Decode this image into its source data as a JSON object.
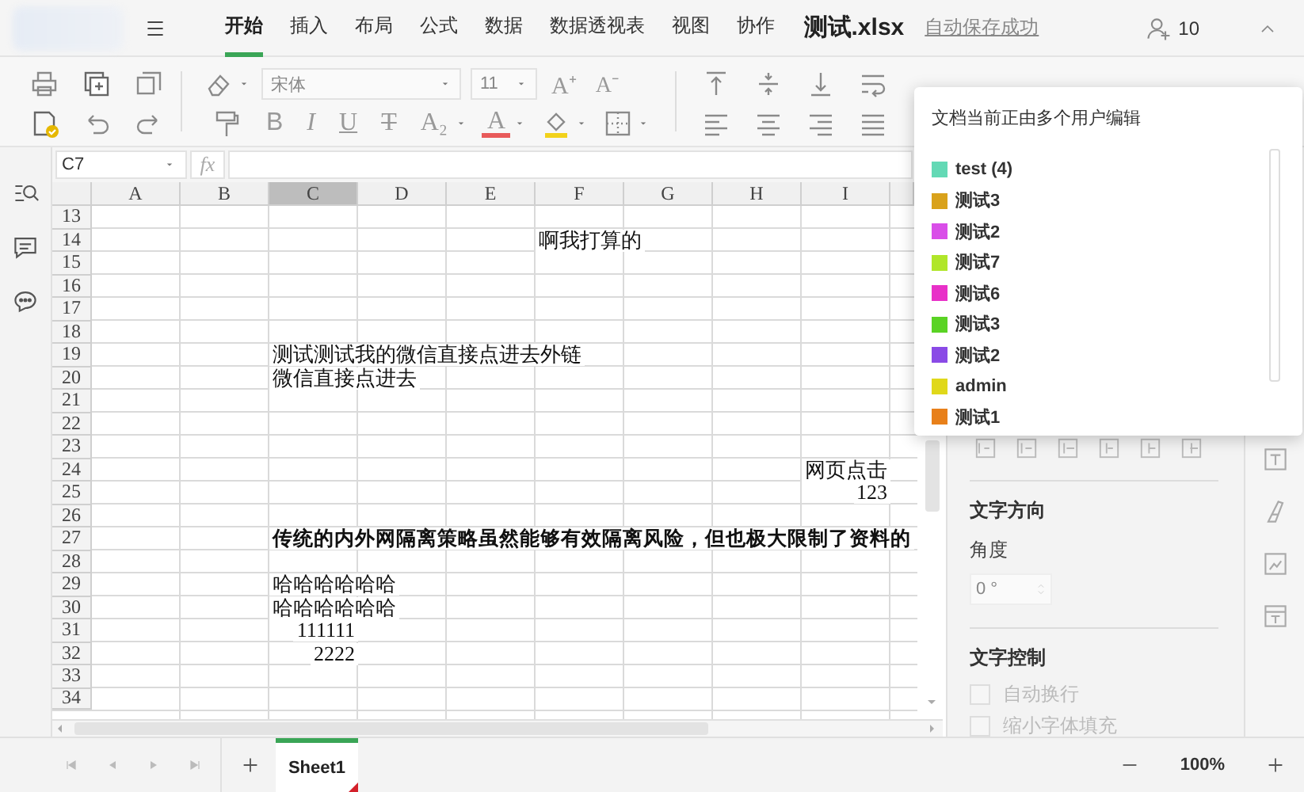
{
  "app_bar": {
    "tabs": [
      {
        "label": "开始",
        "selected": true
      },
      {
        "label": "插入",
        "selected": false
      },
      {
        "label": "布局",
        "selected": false
      },
      {
        "label": "公式",
        "selected": false
      },
      {
        "label": "数据",
        "selected": false
      },
      {
        "label": "数据透视表",
        "selected": false
      },
      {
        "label": "视图",
        "selected": false
      },
      {
        "label": "协作",
        "selected": false
      }
    ],
    "file_name": "测试.xlsx",
    "save_status": "自动保存成功",
    "collaborator_count": "10"
  },
  "toolbar": {
    "font_name": "宋体",
    "font_size": "11",
    "size_buttons": [
      {
        "kind": "grow",
        "glyph": "A⁺"
      },
      {
        "kind": "shrink",
        "glyph": "A⁻"
      }
    ],
    "style_buttons": [
      {
        "kind": "bold",
        "glyph": "B"
      },
      {
        "kind": "italic",
        "glyph": "I"
      },
      {
        "kind": "underline",
        "glyph": "U"
      },
      {
        "kind": "strike",
        "glyph": "T"
      },
      {
        "kind": "subscript",
        "glyph": "A₂"
      },
      {
        "kind": "font_color",
        "glyph": "A"
      }
    ]
  },
  "formula_bar": {
    "cell_ref": "C7",
    "function_label": "fx"
  },
  "sheet": {
    "columns": [
      {
        "label": "A",
        "selected": false
      },
      {
        "label": "B",
        "selected": false
      },
      {
        "label": "C",
        "selected": true
      },
      {
        "label": "D",
        "selected": false
      },
      {
        "label": "E",
        "selected": false
      },
      {
        "label": "F",
        "selected": false
      },
      {
        "label": "G",
        "selected": false
      },
      {
        "label": "H",
        "selected": false
      },
      {
        "label": "I",
        "selected": false
      }
    ],
    "rows": [
      {
        "number": "13"
      },
      {
        "number": "14",
        "f": {
          "text": "啊我打算的",
          "kind": "text",
          "bold": false
        }
      },
      {
        "number": "15"
      },
      {
        "number": "16"
      },
      {
        "number": "17"
      },
      {
        "number": "18"
      },
      {
        "number": "19",
        "c": {
          "text": "测试测试我的微信直接点进去外链",
          "kind": "text",
          "bold": false
        }
      },
      {
        "number": "20",
        "c": {
          "text": "微信直接点进去",
          "kind": "text",
          "bold": false
        }
      },
      {
        "number": "21"
      },
      {
        "number": "22"
      },
      {
        "number": "23"
      },
      {
        "number": "24",
        "i": {
          "text": "网页点击",
          "kind": "text",
          "bold": false
        }
      },
      {
        "number": "25",
        "i": {
          "text": "123",
          "kind": "number",
          "bold": false
        }
      },
      {
        "number": "26"
      },
      {
        "number": "27",
        "c": {
          "text": "传统的内外网隔离策略虽然能够有效隔离风险，但也极大限制了资料的",
          "kind": "text",
          "bold": true
        }
      },
      {
        "number": "28"
      },
      {
        "number": "29",
        "c": {
          "text": "哈哈哈哈哈哈",
          "kind": "text",
          "bold": false
        }
      },
      {
        "number": "30",
        "c": {
          "text": "哈哈哈哈哈哈",
          "kind": "text",
          "bold": false
        }
      },
      {
        "number": "31",
        "c": {
          "text": "111111",
          "kind": "number",
          "bold": false
        }
      },
      {
        "number": "32",
        "c": {
          "text": "2222",
          "kind": "number",
          "bold": false
        }
      },
      {
        "number": "33"
      },
      {
        "number": "34"
      }
    ]
  },
  "panel": {
    "text_direction": {
      "title": "文字方向",
      "angle_label": "角度",
      "angle_value": "0 °"
    },
    "text_control": {
      "title": "文字控制",
      "options": [
        {
          "label": "自动换行",
          "checked": false,
          "disabled": true
        },
        {
          "label": "缩小字体填充",
          "checked": false,
          "disabled": true
        }
      ]
    }
  },
  "popup": {
    "title": "文档当前正由多个用户编辑",
    "users": [
      {
        "name": "test (4)",
        "color": "#63d9b5"
      },
      {
        "name": "测试3",
        "color": "#d9a21b"
      },
      {
        "name": "测试2",
        "color": "#d94ee8"
      },
      {
        "name": "测试7",
        "color": "#b0e62a"
      },
      {
        "name": "测试6",
        "color": "#e830c8"
      },
      {
        "name": "测试3",
        "color": "#5ad324"
      },
      {
        "name": "测试2",
        "color": "#8a4ae6"
      },
      {
        "name": "admin",
        "color": "#e0d81a"
      },
      {
        "name": "测试1",
        "color": "#e8801a"
      }
    ]
  },
  "sheet_bar": {
    "tabs": [
      {
        "label": "Sheet1",
        "selected": true
      }
    ],
    "zoom": "100%"
  }
}
